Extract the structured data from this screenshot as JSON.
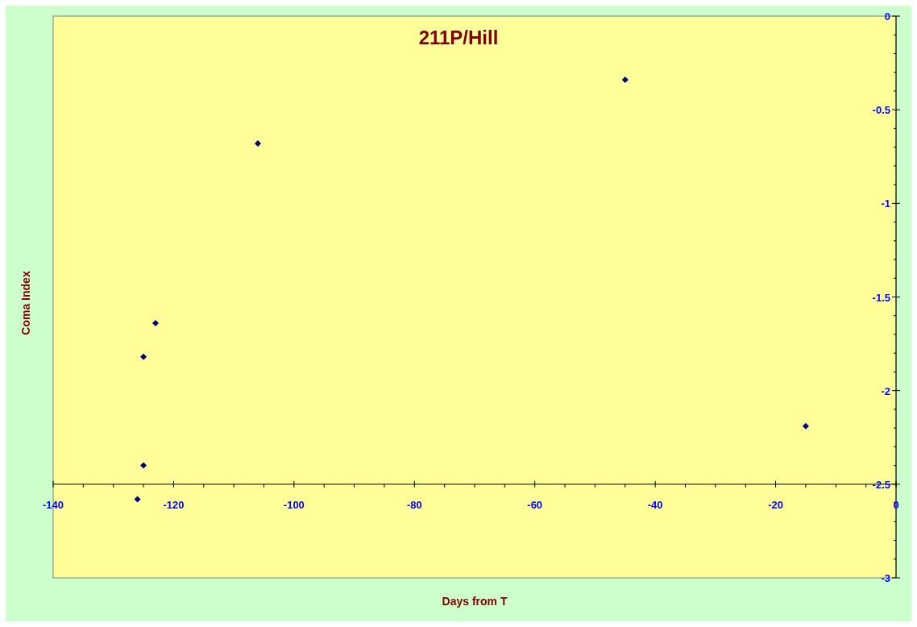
{
  "chart_data": {
    "type": "scatter",
    "title": "211P/Hill",
    "xlabel": "Days from T",
    "ylabel": "Coma Index",
    "x": [
      -126,
      -125,
      -125,
      -123,
      -106,
      -45,
      -15
    ],
    "series": [
      {
        "color": "#000080",
        "values": [
          -2.58,
          -2.4,
          -1.82,
          -1.64,
          -0.68,
          -0.34,
          -2.19
        ]
      }
    ],
    "xlim": [
      -140,
      0
    ],
    "ylim": [
      -3,
      0
    ],
    "xticks": [
      -140,
      -120,
      -100,
      -80,
      -60,
      -40,
      -20,
      0
    ],
    "yticks": [
      0,
      -0.5,
      -1,
      -1.5,
      -2,
      -2.5,
      -3
    ]
  }
}
